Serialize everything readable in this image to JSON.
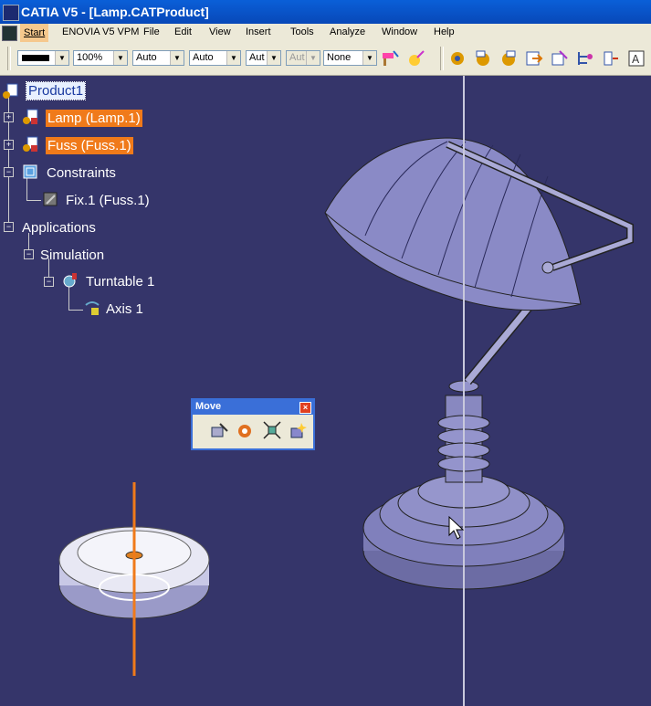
{
  "window": {
    "title": "CATIA V5 - [Lamp.CATProduct]"
  },
  "menu": {
    "start": "Start",
    "items": [
      "ENOVIA V5 VPM",
      "File",
      "Edit",
      "View",
      "Insert",
      "Tools",
      "Analyze",
      "Window",
      "Help"
    ]
  },
  "toolbar": {
    "color_combo": "",
    "transparency_combo": "100%",
    "linetype_combo": "Auto",
    "lineweight_combo": "Auto",
    "combo_aut1": "Aut",
    "combo_aut2": "Aut",
    "layer_combo": "None"
  },
  "tree": {
    "root": "Product1",
    "lamp": "Lamp (Lamp.1)",
    "fuss": "Fuss (Fuss.1)",
    "constraints": "Constraints",
    "fix": "Fix.1 (Fuss.1)",
    "applications": "Applications",
    "simulation": "Simulation",
    "turntable": "Turntable 1",
    "axis": "Axis 1"
  },
  "move_toolbar": {
    "title": "Move",
    "close": "×"
  },
  "colors": {
    "background": "#35356a",
    "highlight": "#f07a1a",
    "title_bar": "#0a5fd8"
  }
}
